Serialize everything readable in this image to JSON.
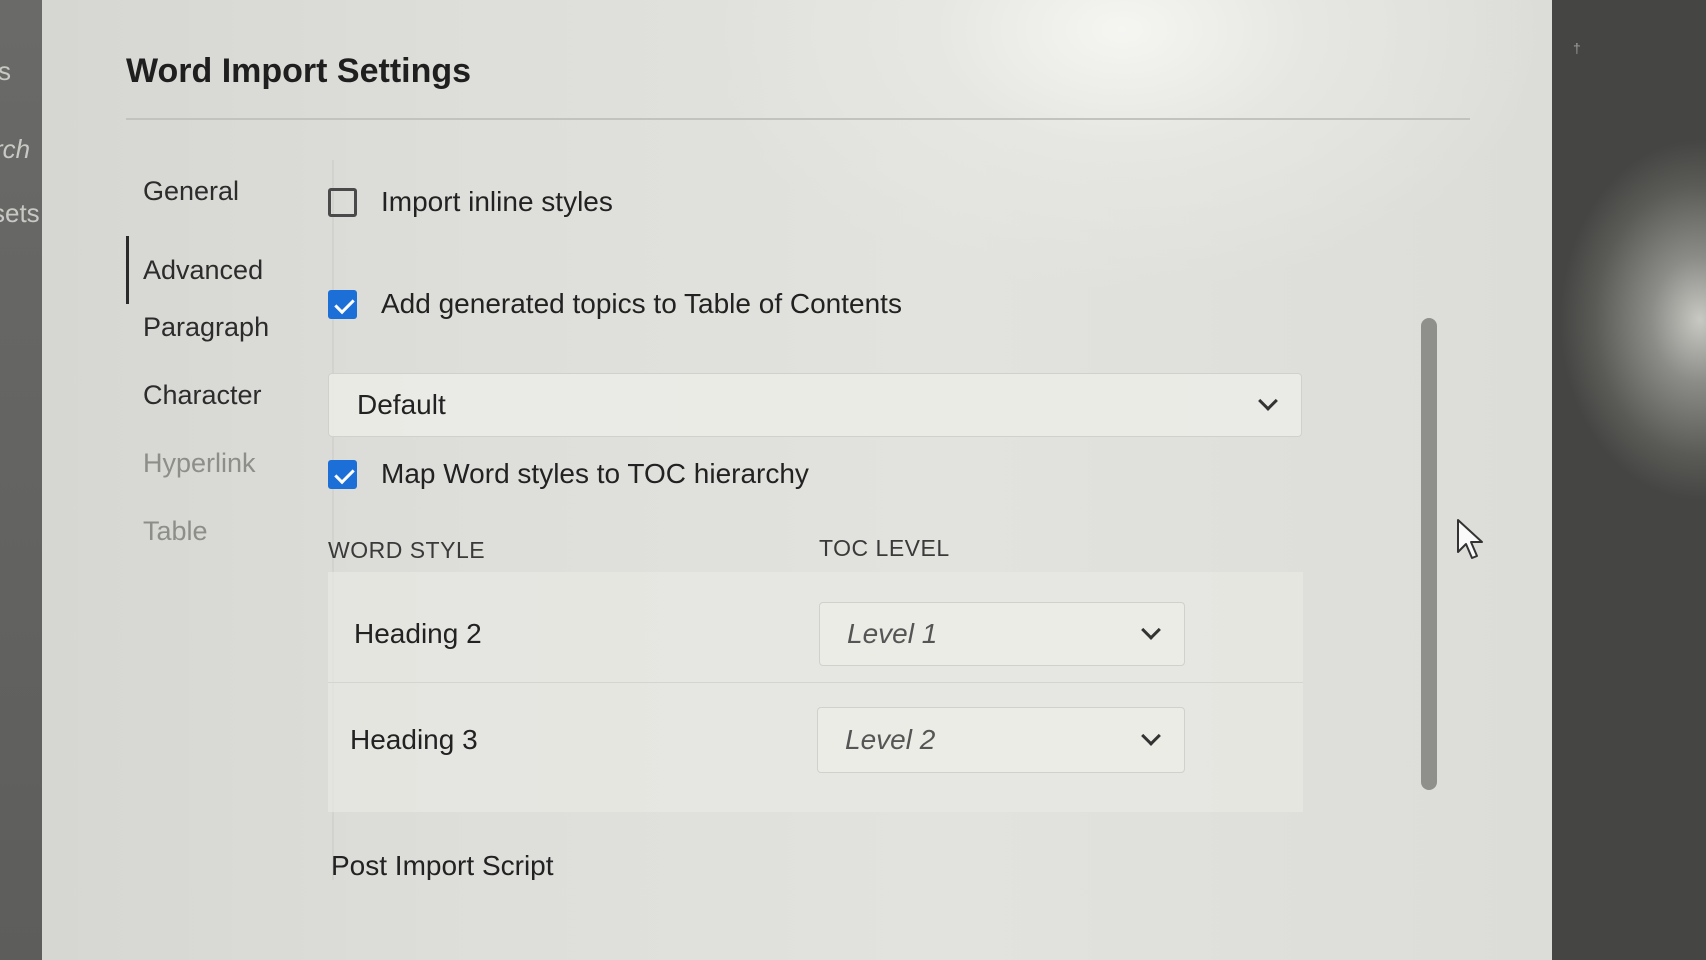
{
  "background_app": {
    "fragments": [
      "s",
      "rch",
      "sets"
    ]
  },
  "dialog": {
    "title": "Word Import Settings",
    "mark": "†"
  },
  "nav": {
    "items": [
      {
        "label": "General",
        "state": "normal"
      },
      {
        "label": "Advanced",
        "state": "active"
      },
      {
        "label": "Paragraph",
        "state": "normal"
      },
      {
        "label": "Character",
        "state": "normal"
      },
      {
        "label": "Hyperlink",
        "state": "dim"
      },
      {
        "label": "Table",
        "state": "dim"
      }
    ]
  },
  "options": {
    "import_inline_styles": {
      "label": "Import inline styles",
      "checked": false
    },
    "add_to_toc": {
      "label": "Add generated topics to Table of Contents",
      "checked": true
    },
    "toc_dropdown": {
      "value": "Default"
    },
    "map_styles": {
      "label": "Map Word styles to TOC hierarchy",
      "checked": true
    }
  },
  "mapping_table": {
    "headers": {
      "word_style": "WORD STYLE",
      "toc_level": "TOC LEVEL"
    },
    "rows": [
      {
        "word_style": "Heading 2",
        "toc_level": "Level 1"
      },
      {
        "word_style": "Heading 3",
        "toc_level": "Level 2"
      }
    ]
  },
  "post_import": {
    "title": "Post Import Script"
  },
  "colors": {
    "accent": "#1d6fd8",
    "dialog_bg": "#dededa",
    "text": "#222222",
    "dim_text": "#8d8d8a"
  },
  "icons": {
    "checkbox_checked": "checkmark-icon",
    "dropdown": "chevron-down-icon",
    "cursor": "mouse-pointer-icon"
  }
}
